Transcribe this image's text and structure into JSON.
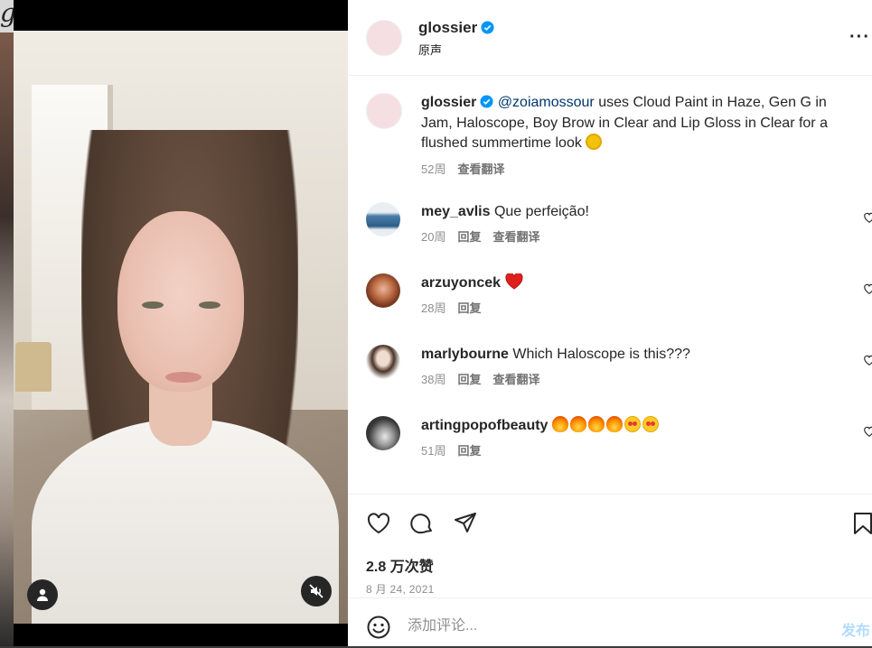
{
  "backdrop": {
    "logo_fragment": "g"
  },
  "header": {
    "username": "glossier",
    "subtitle": "原声",
    "more_label": "···"
  },
  "caption": {
    "username": "glossier",
    "mention": "@zoiamossour",
    "text": " uses Cloud Paint in Haze, Gen G in Jam, Haloscope, Boy Brow in Clear and Lip Gloss in Clear for a flushed summertime look ",
    "emoji": "sun-emoji",
    "time": "52周",
    "translate": "查看翻译"
  },
  "comments": [
    {
      "username": "mey_avlis",
      "text": " Que perfeição!",
      "time": "20周",
      "reply": "回复",
      "translate": "查看翻译"
    },
    {
      "username": "arzuyoncek",
      "text": " ",
      "emoji": "red-heart",
      "time": "28周",
      "reply": "回复",
      "translate": ""
    },
    {
      "username": "marlybourne",
      "text": " Which Haloscope is this???",
      "time": "38周",
      "reply": "回复",
      "translate": "查看翻译"
    },
    {
      "username": "artingpopofbeauty",
      "text": " ",
      "emoji": "fire x4, heart-eyes x2",
      "time": "51周",
      "reply": "回复",
      "translate": ""
    }
  ],
  "actions": {
    "likes": "2.8 万次赞",
    "date": "8 月 24, 2021"
  },
  "comment_box": {
    "placeholder": "添加评论...",
    "post_label": "发布"
  },
  "colors": {
    "link": "#00376b",
    "verified": "#0095f6",
    "post_disabled": "#b3dbff",
    "muted": "#8e8e8e"
  }
}
